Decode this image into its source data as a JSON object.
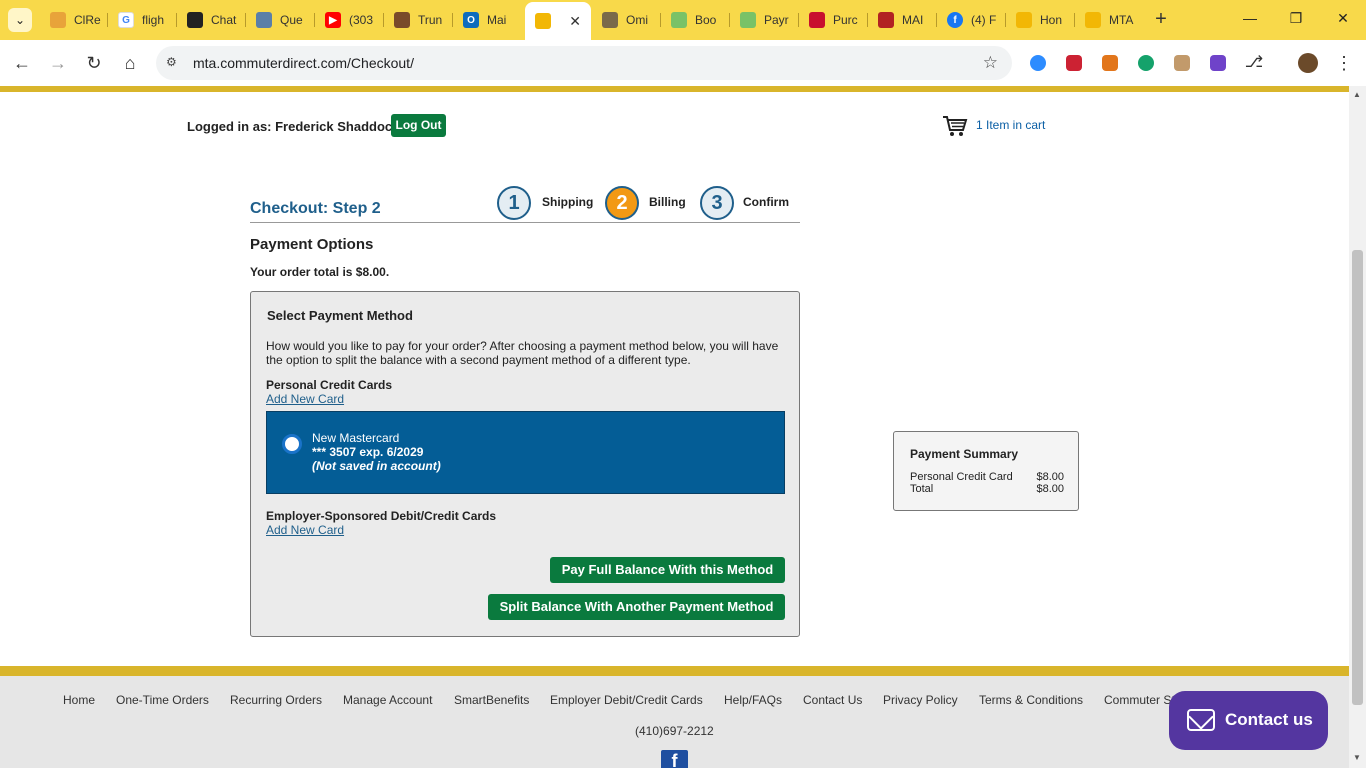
{
  "browser": {
    "tabs": [
      {
        "label": "ClRe",
        "icon": "chrome-favicon",
        "color": "#e8a33a"
      },
      {
        "label": "fligh",
        "icon": "google-favicon",
        "color": "#4285f4"
      },
      {
        "label": "Chat",
        "icon": "openai-favicon",
        "color": "#222222"
      },
      {
        "label": "Que",
        "icon": "folder-favicon",
        "color": "#5a7fa8"
      },
      {
        "label": "(303",
        "icon": "youtube-favicon",
        "color": "#ff0000"
      },
      {
        "label": "Trun",
        "icon": "store-favicon",
        "color": "#7a4b2a"
      },
      {
        "label": "Mai",
        "icon": "outlook-favicon",
        "color": "#0f6cbd"
      },
      {
        "label": "",
        "icon": "mta-favicon",
        "color": "#f2b705",
        "active": true
      },
      {
        "label": "Omi",
        "icon": "omi-favicon",
        "color": "#7a6a4a"
      },
      {
        "label": "Boo",
        "icon": "book-favicon",
        "color": "#79c267"
      },
      {
        "label": "Payr",
        "icon": "pay-favicon",
        "color": "#79c267"
      },
      {
        "label": "Purc",
        "icon": "southwest-favicon",
        "color": "#c8102e"
      },
      {
        "label": "MAI",
        "icon": "mai-favicon",
        "color": "#b22222"
      },
      {
        "label": "(4) F",
        "icon": "facebook-favicon",
        "color": "#1877f2"
      },
      {
        "label": "Hon",
        "icon": "mta-favicon",
        "color": "#f2b705"
      },
      {
        "label": "MTA",
        "icon": "mta-favicon",
        "color": "#f2b705"
      }
    ],
    "url": "mta.commuterdirect.com/Checkout/",
    "extensions": [
      {
        "name": "zoom-extension-icon",
        "color": "#2d8cff"
      },
      {
        "name": "vm-extension-icon",
        "color": "#cc2233"
      },
      {
        "name": "metamask-extension-icon",
        "color": "#e2761b"
      },
      {
        "name": "grammarly-extension-icon",
        "color": "#15a26b"
      },
      {
        "name": "cat-extension-icon",
        "color": "#c29a6b"
      },
      {
        "name": "twitch-extension-icon",
        "color": "#6f43c9"
      }
    ]
  },
  "header": {
    "login_text": "Logged in as: Frederick Shaddock",
    "logout_label": "Log Out",
    "cart_text": "1 Item in cart"
  },
  "checkout": {
    "title": "Checkout: Step 2",
    "steps": [
      {
        "num": "1",
        "label": "Shipping"
      },
      {
        "num": "2",
        "label": "Billing",
        "current": true
      },
      {
        "num": "3",
        "label": "Confirm"
      }
    ],
    "heading": "Payment Options",
    "order_total": "Your order total is $8.00."
  },
  "payment_method": {
    "title": "Select Payment Method",
    "description": "How would you like to pay for your order? After choosing a payment method below, you will have the option to split the balance with a second payment method of a different type.",
    "personal_label": "Personal Credit Cards",
    "add_card_label": "Add New Card",
    "card": {
      "name": "New Mastercard",
      "number": "*** 3507 exp. 6/2029",
      "note": "(Not saved in account)"
    },
    "employer_label": "Employer-Sponsored Debit/Credit Cards",
    "employer_add_label": "Add New Card",
    "pay_full_label": "Pay Full Balance With this Method",
    "split_label": "Split Balance With Another Payment Method"
  },
  "summary": {
    "title": "Payment Summary",
    "rows": [
      {
        "label": "Personal Credit Card",
        "amount": "$8.00"
      },
      {
        "label": "Total",
        "amount": "$8.00"
      }
    ]
  },
  "footer": {
    "links": [
      "Home",
      "One-Time Orders",
      "Recurring Orders",
      "Manage Account",
      "SmartBenefits",
      "Employer Debit/Credit Cards",
      "Help/FAQs",
      "Contact Us",
      "Privacy Policy",
      "Terms & Conditions",
      "Commuter St"
    ],
    "phone": "(410)697-2212",
    "facebook": "f"
  },
  "contact": {
    "label": "Contact us"
  },
  "colors": {
    "brand_gold": "#d9b52b",
    "brand_green": "#0a7a3e",
    "brand_blue": "#045d96",
    "contact_purple": "#5436a0"
  }
}
